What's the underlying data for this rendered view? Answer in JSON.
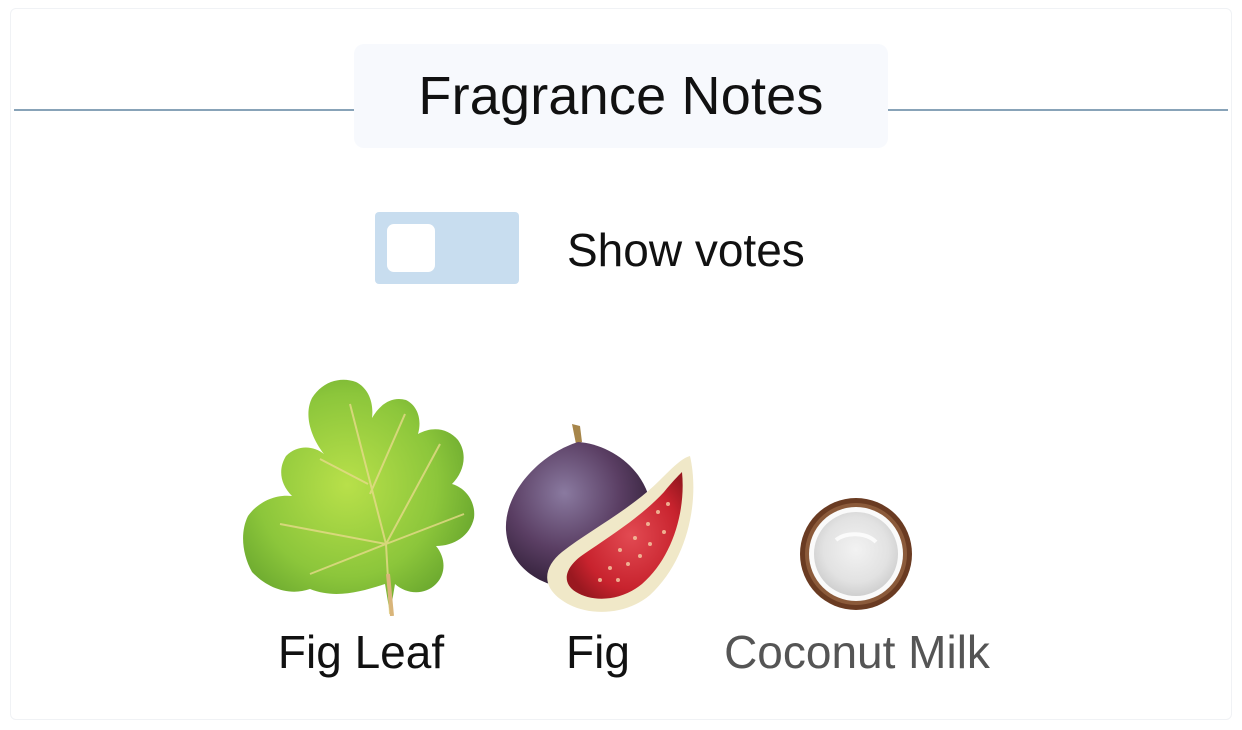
{
  "section": {
    "title": "Fragrance Notes"
  },
  "votes_toggle": {
    "label": "Show votes",
    "checked": false,
    "track_color": "#c8ddef"
  },
  "notes": [
    {
      "name": "Fig Leaf",
      "icon": "fig-leaf-icon",
      "text_color": "#111111"
    },
    {
      "name": "Fig",
      "icon": "fig-icon",
      "text_color": "#111111"
    },
    {
      "name": "Coconut Milk",
      "icon": "coconut-icon",
      "text_color": "#555555"
    }
  ]
}
